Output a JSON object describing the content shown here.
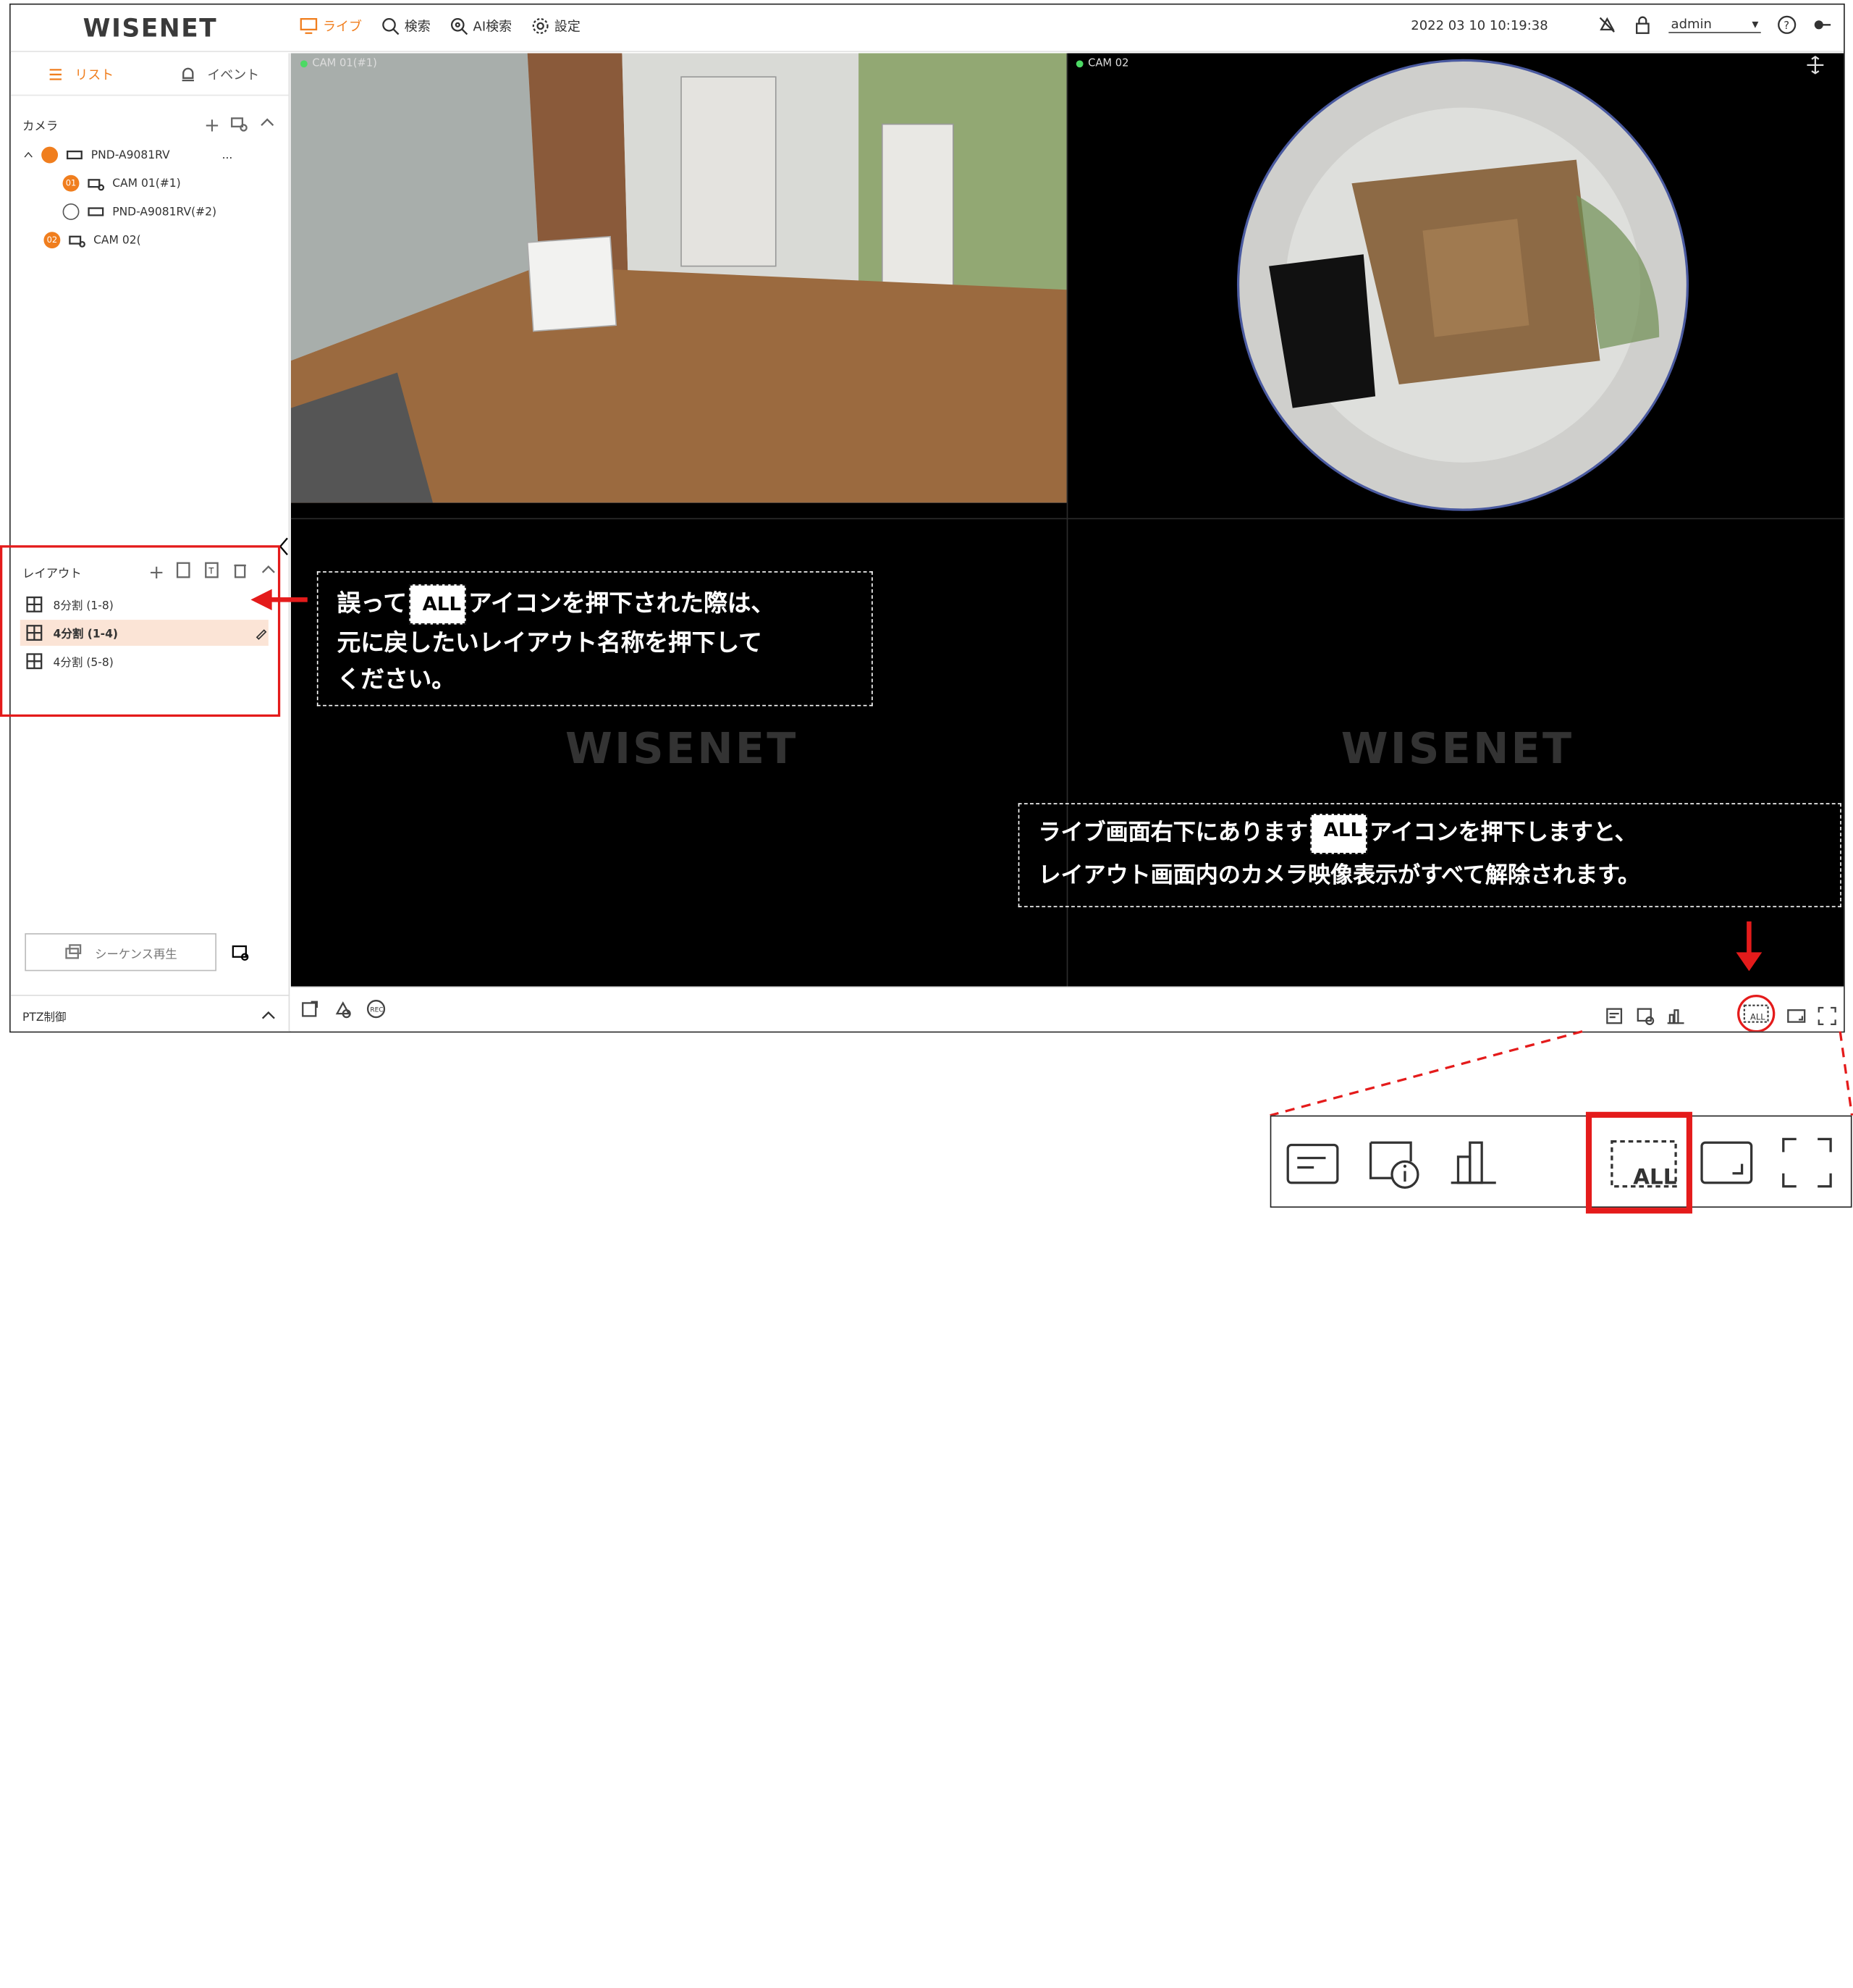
{
  "app": {
    "logo": "WISENET"
  },
  "nav": [
    {
      "label": "ライブ",
      "icon": "monitor-icon"
    },
    {
      "label": "検索",
      "icon": "search-icon"
    },
    {
      "label": "AI検索",
      "icon": "ai-search-icon"
    },
    {
      "label": "設定",
      "icon": "gear-icon"
    }
  ],
  "header": {
    "datetime": "2022 03 10 10:19:38",
    "user": "admin",
    "user_caret": "▾"
  },
  "sidebar": {
    "tabs": [
      {
        "label": "リスト"
      },
      {
        "label": "イベント"
      }
    ],
    "camera_section": {
      "title": "カメラ"
    },
    "tree": [
      {
        "label": "PND-A9081RV",
        "more": "..."
      },
      {
        "badge": "01",
        "label": "CAM 01(#1)"
      },
      {
        "label": "PND-A9081RV(#2)"
      },
      {
        "badge": "02",
        "label": "CAM 02("
      }
    ],
    "layout_section": {
      "title": "レイアウト"
    },
    "layouts": [
      {
        "label": "8分割 (1-8)"
      },
      {
        "label": "4分割 (1-4)"
      },
      {
        "label": "4分割 (5-8)"
      }
    ],
    "sequence_button": "シーケンス再生",
    "ptz_label": "PTZ制御"
  },
  "video": {
    "cam1": "CAM 01(#1)",
    "cam2": "CAM 02",
    "watermark1": "WISENET",
    "watermark2": "WISENET"
  },
  "annotations": {
    "left_line1_a": "誤って",
    "left_line1_b": "アイコンを押下された際は、",
    "left_line2": "元に戻したいレイアウト名称を押下して",
    "left_line3": "ください。",
    "right_line1_a": "ライブ画面右下にあります",
    "right_line1_b": "アイコンを押下しますと、",
    "right_line2": "レイアウト画面内のカメラ映像表示がすべて解除されます。",
    "all_icon_text": "ALL"
  },
  "colors": {
    "accent": "#f07e1e",
    "annotation_red": "#e41b1b",
    "video_bg": "#000000"
  }
}
